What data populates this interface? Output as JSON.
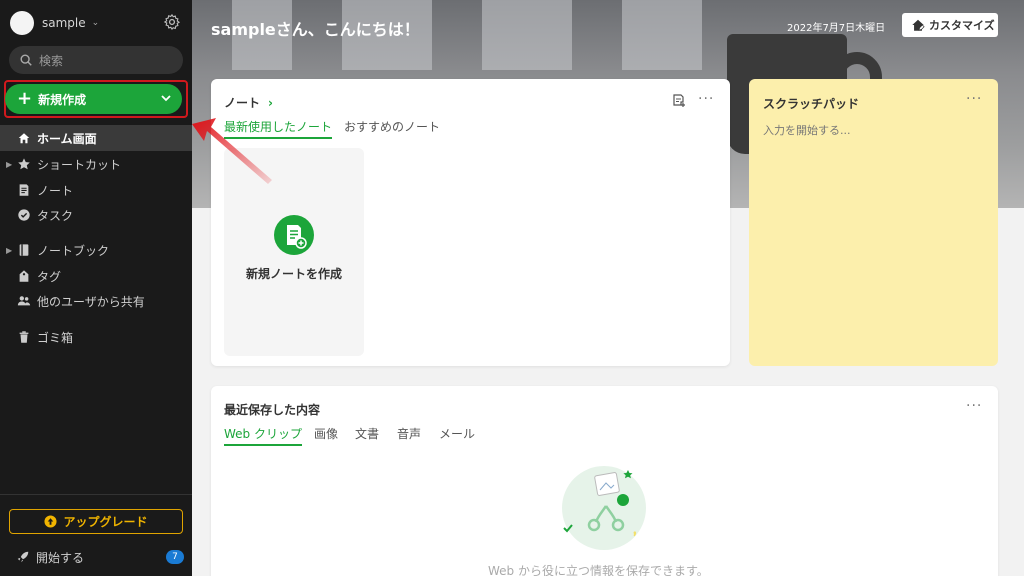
{
  "sidebar": {
    "user_name": "sample",
    "search_placeholder": "検索",
    "new_button_label": "新規作成",
    "items": [
      {
        "label": "ホーム画面",
        "icon": "home-icon",
        "active": true
      },
      {
        "label": "ショートカット",
        "icon": "star-icon",
        "expandable": true
      },
      {
        "label": "ノート",
        "icon": "note-icon"
      },
      {
        "label": "タスク",
        "icon": "task-check-icon"
      },
      {
        "label": "ノートブック",
        "icon": "notebook-icon",
        "expandable": true
      },
      {
        "label": "タグ",
        "icon": "tag-icon"
      },
      {
        "label": "他のユーザから共有",
        "icon": "shared-users-icon"
      },
      {
        "label": "ゴミ箱",
        "icon": "trash-icon"
      }
    ],
    "upgrade_label": "アップグレード",
    "start_label": "開始する",
    "start_badge": "7"
  },
  "header": {
    "greeting": "sampleさん、こんにちは！",
    "date": "2022年7月7日木曜日",
    "customize_label": "カスタマイズ"
  },
  "notes_card": {
    "title": "ノート",
    "tabs": [
      "最新使用したノート",
      "おすすめのノート"
    ],
    "new_note_label": "新規ノートを作成"
  },
  "scratchpad": {
    "title": "スクラッチパッド",
    "placeholder": "入力を開始する..."
  },
  "recent_card": {
    "title": "最近保存した内容",
    "tabs": [
      "Web クリップ",
      "画像",
      "文書",
      "音声",
      "メール"
    ],
    "empty_text": "Web から役に立つ情報を保存できます。"
  },
  "colors": {
    "accent_green": "#1ca53a",
    "highlight_red": "#d0191d",
    "scratchpad_yellow": "#fcefac",
    "upgrade_gold": "#f0b400"
  }
}
